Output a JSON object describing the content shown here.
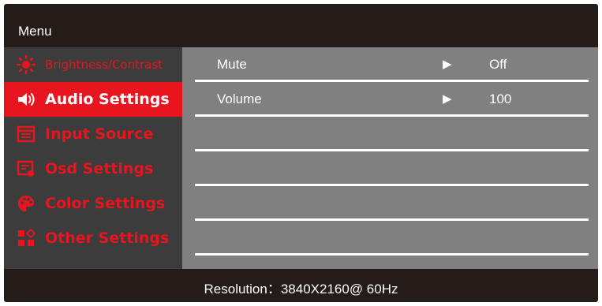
{
  "header": {
    "title": "Menu"
  },
  "sidebar": {
    "items": [
      {
        "label": "Brightness/Contrast",
        "icon": "brightness-icon",
        "active": false
      },
      {
        "label": "Audio Settings",
        "icon": "speaker-icon",
        "active": true
      },
      {
        "label": "Input Source",
        "icon": "input-source-icon",
        "active": false
      },
      {
        "label": "Osd Settings",
        "icon": "osd-settings-icon",
        "active": false
      },
      {
        "label": "Color Settings",
        "icon": "palette-icon",
        "active": false
      },
      {
        "label": "Other Settings",
        "icon": "other-settings-icon",
        "active": false
      }
    ]
  },
  "content": {
    "rows": [
      {
        "label": "Mute",
        "arrow": "▶",
        "value": "Off"
      },
      {
        "label": "Volume",
        "arrow": "▶",
        "value": "100"
      }
    ]
  },
  "footer": {
    "resolution": "Resolution：3840X2160@ 60Hz"
  },
  "colors": {
    "background": "#231c18",
    "sidebar": "#3c3c3c",
    "accent": "#e8141e",
    "content": "#808080",
    "text": "#ffffff"
  }
}
